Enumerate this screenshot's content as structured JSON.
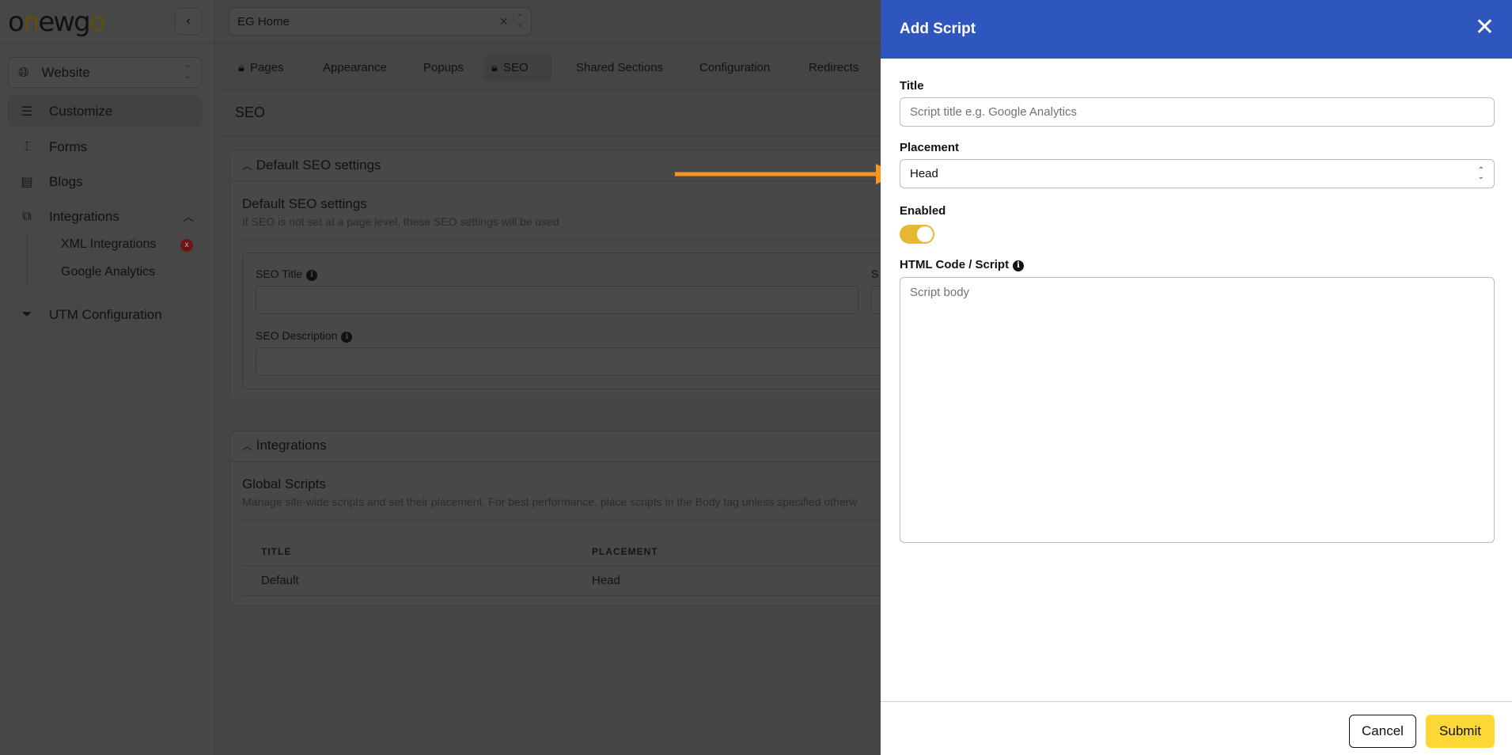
{
  "brand": {
    "logo_text": "onewgo"
  },
  "topbar": {
    "page_select_value": "EG Home"
  },
  "sidebar": {
    "site_select": "Website",
    "items": [
      {
        "label": "Customize",
        "icon": "sliders-icon"
      },
      {
        "label": "Forms",
        "icon": "form-icon"
      },
      {
        "label": "Blogs",
        "icon": "newspaper-icon"
      },
      {
        "label": "Integrations",
        "icon": "puzzle-icon"
      },
      {
        "label": "UTM Configuration",
        "icon": "filter-icon"
      }
    ],
    "sub_items": [
      {
        "label": "XML Integrations",
        "badge": "x"
      },
      {
        "label": "Google Analytics"
      }
    ]
  },
  "tabs": [
    {
      "label": "Pages",
      "locked": true
    },
    {
      "label": "Appearance"
    },
    {
      "label": "Popups"
    },
    {
      "label": "SEO",
      "locked": true,
      "active": true
    },
    {
      "label": "Shared Sections"
    },
    {
      "label": "Configuration"
    },
    {
      "label": "Redirects"
    }
  ],
  "page": {
    "title": "SEO",
    "seo_card": {
      "header": "Default SEO settings",
      "title": "Default SEO settings",
      "subtitle": "If SEO is not set at a page level, these SEO settings will be used",
      "seo_title_label": "SEO Title",
      "seo_description_label": "SEO Description",
      "cut_label": "S"
    },
    "integrations_card": {
      "header": "Integrations",
      "title": "Global Scripts",
      "subtitle": "Manage site-wide scripts and set their placement. For best performance, place scripts in the Body tag unless specified otherw",
      "columns": [
        "TITLE",
        "PLACEMENT"
      ],
      "rows": [
        {
          "title": "Default",
          "placement": "Head"
        }
      ]
    }
  },
  "drawer": {
    "title": "Add Script",
    "title_label": "Title",
    "title_placeholder": "Script title e.g. Google Analytics",
    "placement_label": "Placement",
    "placement_value": "Head",
    "enabled_label": "Enabled",
    "enabled": true,
    "code_label": "HTML Code / Script",
    "code_placeholder": "Script body",
    "cancel": "Cancel",
    "submit": "Submit"
  },
  "colors": {
    "header_blue": "#2f55be",
    "accent_yellow": "#fdd835",
    "toggle_on": "#e5b732",
    "arrow": "#f7931e"
  }
}
